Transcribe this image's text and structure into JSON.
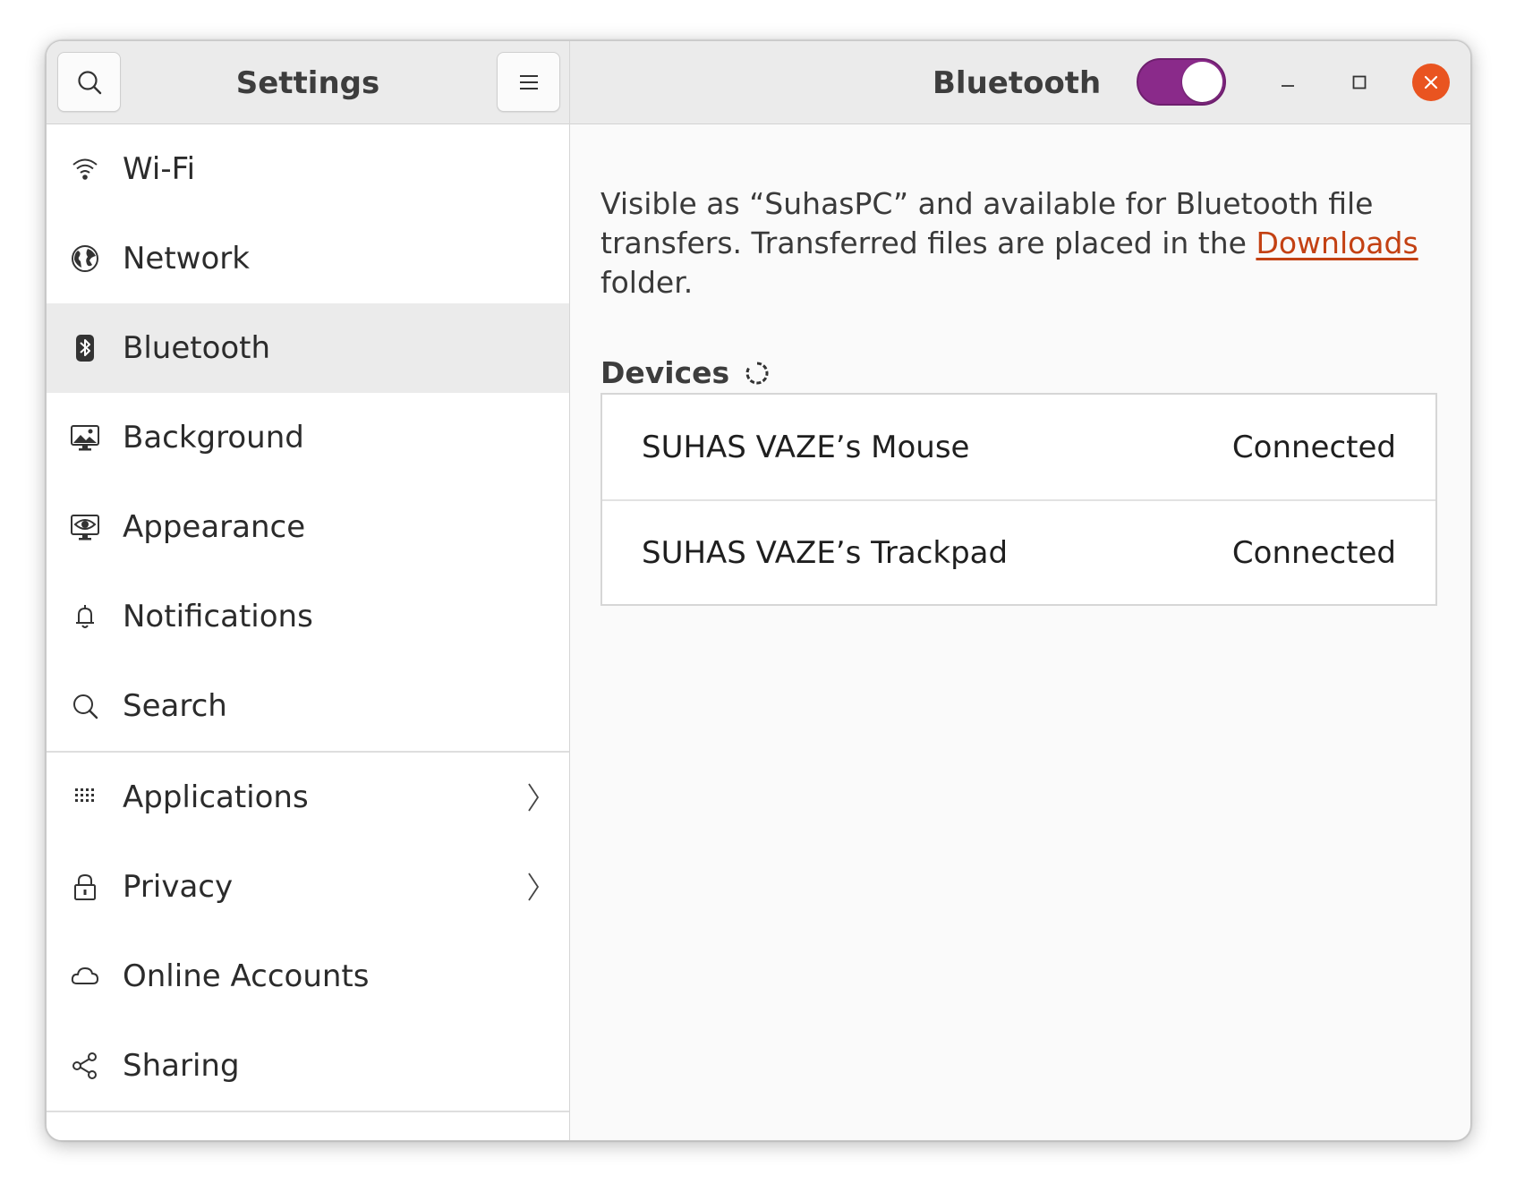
{
  "sidebar": {
    "title": "Settings",
    "items": [
      {
        "label": "Wi-Fi",
        "icon": "wifi-icon"
      },
      {
        "label": "Network",
        "icon": "globe-icon"
      },
      {
        "label": "Bluetooth",
        "icon": "bluetooth-icon",
        "active": true
      },
      {
        "label": "Background",
        "icon": "monitor-icon"
      },
      {
        "label": "Appearance",
        "icon": "appearance-icon"
      },
      {
        "label": "Notifications",
        "icon": "bell-icon"
      },
      {
        "label": "Search",
        "icon": "search-icon"
      },
      {
        "label": "Applications",
        "icon": "grid-icon",
        "has_submenu": true
      },
      {
        "label": "Privacy",
        "icon": "lock-icon",
        "has_submenu": true
      },
      {
        "label": "Online Accounts",
        "icon": "cloud-icon"
      },
      {
        "label": "Sharing",
        "icon": "share-icon"
      }
    ]
  },
  "header": {
    "title": "Bluetooth",
    "bluetooth_enabled": true
  },
  "main": {
    "description_prefix": "Visible as “SuhasPC” and available for Bluetooth file transfers. Transferred files are placed in the ",
    "description_link": "Downloads",
    "description_suffix": " folder.",
    "devices_heading": "Devices",
    "devices": [
      {
        "name": "SUHAS VAZE’s Mouse",
        "status": "Connected"
      },
      {
        "name": "SUHAS VAZE’s Trackpad",
        "status": "Connected"
      }
    ]
  },
  "colors": {
    "accent": "#8a2a8a",
    "close_button": "#e95420",
    "link": "#c34113",
    "active_item_bg": "#ebebeb"
  }
}
